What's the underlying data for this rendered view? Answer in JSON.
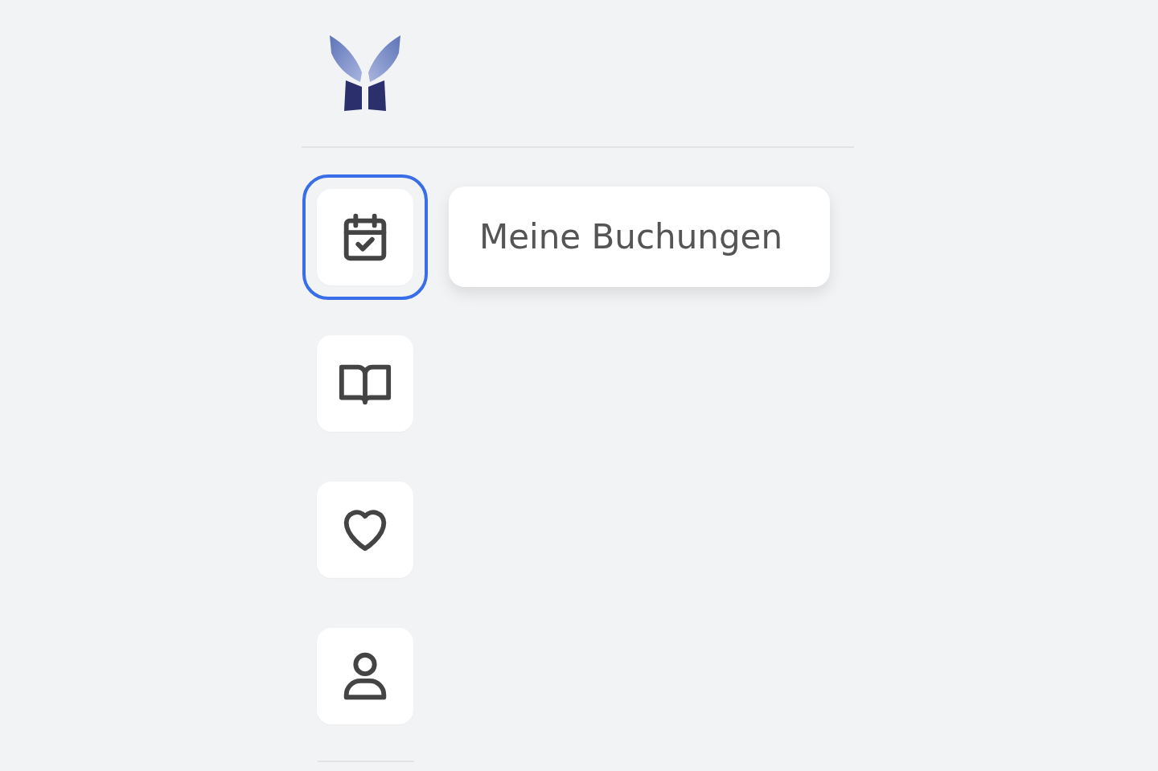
{
  "nav": {
    "items": [
      {
        "kind": "calendar",
        "selected": true
      },
      {
        "kind": "book",
        "selected": false
      },
      {
        "kind": "heart",
        "selected": false
      },
      {
        "kind": "user",
        "selected": false
      }
    ]
  },
  "tooltip": {
    "text": "Meine Buchungen"
  }
}
